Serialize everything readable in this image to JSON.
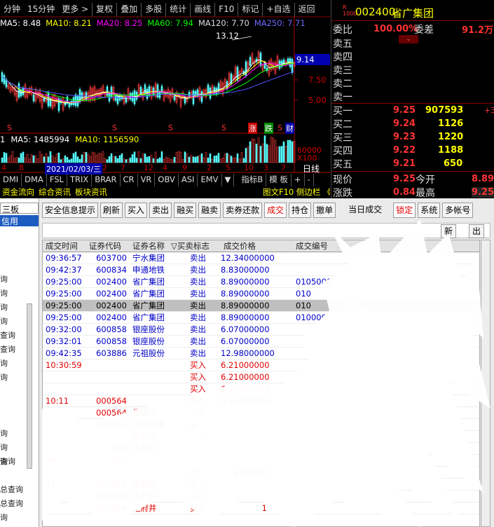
{
  "chart": {
    "top_items": [
      "分钟",
      "15分钟",
      "更多 >"
    ],
    "top_buttons": [
      "复权",
      "叠加",
      "多股",
      "统计",
      "画线",
      "F10",
      "标记",
      "+自选",
      "返回"
    ],
    "ma_legend": {
      "ma5": "MA5: 8.48",
      "ma10": "MA10: 8.21",
      "ma20": "MA20: 8.25",
      "ma60": "MA60: 7.94",
      "ma120": "MA120: 7.70",
      "ma250": "MA250: 7.71"
    },
    "peak_label": "13.12",
    "price_axis": [
      "9.14",
      "7.50",
      "5.00"
    ],
    "markers": {
      "s": "S",
      "zhang": "涨",
      "die": "跌",
      "cai": "财"
    },
    "volume_legend": {
      "prefix": "1",
      "ma5": "MA5: 1485994",
      "ma10": "MA10: 1156590"
    },
    "volume_axis": [
      "60000",
      "X100"
    ],
    "date_labels": [
      "4",
      "8",
      "2021/02/03/三",
      "2",
      "7",
      "12",
      "4",
      "9",
      "2",
      "5",
      "10",
      "3",
      "7"
    ],
    "indicator_tabs": [
      "DMI",
      "DMA",
      "FSL",
      "TRIX",
      "BRAR",
      "CR",
      "VR",
      "OBV",
      "ASI",
      "EMV",
      "▼"
    ],
    "indicator_right": [
      "指标B",
      "模 板",
      "+",
      "-"
    ],
    "period_label": "日线",
    "info_tabs": [
      "资金流向",
      "综合资讯",
      "板块资讯"
    ],
    "info_right": "图文F10 侧边栏 《",
    "colors": {
      "up": "#ff3c3c",
      "down": "#54fcfc",
      "ma5": "#ffffff",
      "ma10": "#ffff00",
      "ma20": "#ff00ff",
      "ma60": "#00ff00",
      "ma120": "#ffffff",
      "ma250": "#5050ff"
    }
  },
  "quote": {
    "code_prefix": "R\n1000",
    "code": "002400",
    "name": "省广集团",
    "ratio_label": "委比",
    "ratio_value": "100.00%",
    "diff_label": "委差",
    "diff_value": "91.2万",
    "sell_rows": [
      "卖五",
      "卖四",
      "卖三",
      "卖二",
      "卖一"
    ],
    "buy_rows": [
      {
        "label": "买一",
        "price": "9.25",
        "vol": "907593",
        "extra": "+3"
      },
      {
        "label": "买二",
        "price": "9.24",
        "vol": "1126",
        "extra": ""
      },
      {
        "label": "买三",
        "price": "9.23",
        "vol": "1220",
        "extra": ""
      },
      {
        "label": "买四",
        "price": "9.22",
        "vol": "1188",
        "extra": ""
      },
      {
        "label": "买五",
        "price": "9.21",
        "vol": "650",
        "extra": ""
      }
    ],
    "now_label": "现价",
    "now_value": "9.25",
    "open_label": "今开",
    "open_value": "8.89",
    "change_label": "涨跌",
    "change_value": "0.84",
    "high_label": "最高",
    "high_value": "9.25"
  },
  "sidebar": {
    "header": "三板",
    "active": "信用",
    "items": [
      "询",
      "询",
      "询",
      "询",
      "查询",
      "查询",
      "询",
      "询",
      "询",
      "询",
      "询",
      "查询",
      "总查询",
      "总查询",
      "询"
    ]
  },
  "toolbar": {
    "buttons": [
      "安全信息提示",
      "刷新",
      "买入",
      "卖出",
      "融买",
      "融卖",
      "卖券还款",
      "成交",
      "持仓",
      "撤单"
    ],
    "today_label": "当日成交",
    "right_buttons": [
      "锁定",
      "系统",
      "多帐号"
    ],
    "sub_buttons": [
      "新",
      "出"
    ]
  },
  "table": {
    "headers": [
      "成交时间",
      "证券代码",
      "证券名称",
      "▽买卖标志",
      "成交价格",
      "成交编号"
    ],
    "rows": [
      {
        "time": "09:36:57",
        "code": "603700",
        "name": "宁水集团",
        "side": "卖出",
        "price": "12.34000000",
        "no": "",
        "type": "sell"
      },
      {
        "time": "09:42:37",
        "code": "600834",
        "name": "申通地铁",
        "side": "卖出",
        "price": "8.83000000",
        "no": "",
        "type": "sell"
      },
      {
        "time": "09:25:00",
        "code": "002400",
        "name": "省广集团",
        "side": "卖出",
        "price": "8.89000000",
        "no": "0105000",
        "type": "sell"
      },
      {
        "time": "09:25:00",
        "code": "002400",
        "name": "省广集团",
        "side": "卖出",
        "price": "8.89000000",
        "no": "010",
        "type": "sell"
      },
      {
        "time": "09:25:00",
        "code": "002400",
        "name": "省广集团",
        "side": "卖出",
        "price": "8.89000000",
        "no": "010",
        "type": "selected"
      },
      {
        "time": "09:25:00",
        "code": "002400",
        "name": "省广集团",
        "side": "卖出",
        "price": "8.89000000",
        "no": "010000",
        "type": "sell"
      },
      {
        "time": "09:32:00",
        "code": "600858",
        "name": "银座股份",
        "side": "卖出",
        "price": "6.07000000",
        "no": "",
        "type": "sell"
      },
      {
        "time": "09:32:01",
        "code": "600858",
        "name": "银座股份",
        "side": "卖出",
        "price": "6.07000000",
        "no": "",
        "type": "sell"
      },
      {
        "time": "09:42:35",
        "code": "603886",
        "name": "元祖股份",
        "side": "卖出",
        "price": "12.98000000",
        "no": "",
        "type": "sell"
      },
      {
        "time": "10:30:59",
        "code": "",
        "name": "",
        "side": "买入",
        "price": "6.21000000",
        "no": "",
        "type": "buy"
      },
      {
        "time": "",
        "code": "",
        "name": "",
        "side": "买入",
        "price": "6.21000000",
        "no": "",
        "type": "buy"
      },
      {
        "time": "",
        "code": "",
        "name": "",
        "side": "买入",
        "price": "6.21000000",
        "no": "",
        "type": "buy"
      },
      {
        "time": "10:11",
        "code": "000564",
        "name": "",
        "side": "买入",
        "price": "6.16000000",
        "no": "",
        "type": "buy"
      },
      {
        "time": "",
        "code": "000564",
        "name": "供销大集",
        "side": "买入",
        "price": "",
        "no": "",
        "type": "buy"
      },
      {
        "time": "",
        "code": "000564",
        "name": "供销大集",
        "side": "买入",
        "price": "",
        "no": "",
        "type": "buy"
      },
      {
        "time": "",
        "code": "",
        "name": "大北农",
        "side": "买入",
        "price": "",
        "no": "",
        "type": "buy"
      },
      {
        "time": "",
        "code": "385",
        "name": "大北农",
        "side": "",
        "price": "",
        "no": "",
        "type": "buy"
      },
      {
        "time": "04",
        "code": "385",
        "name": "",
        "side": "",
        "price": "",
        "no": "",
        "type": "buy"
      },
      {
        "time": "",
        "code": "",
        "name": "",
        "side": "买入",
        "price": "9.68000",
        "no": "",
        "type": "buy"
      },
      {
        "time": "17",
        "code": "600859",
        "name": "王府井",
        "side": "买入",
        "price": "",
        "no": "",
        "type": "buy"
      },
      {
        "time": "",
        "code": "600859",
        "name": "王府井",
        "side": "买入",
        "price": "",
        "no": "",
        "type": "buy"
      },
      {
        "time": "",
        "code": "600859",
        "name": "王府井",
        "side": "买入",
        "price": "1",
        "no": "",
        "type": "buy"
      }
    ]
  }
}
